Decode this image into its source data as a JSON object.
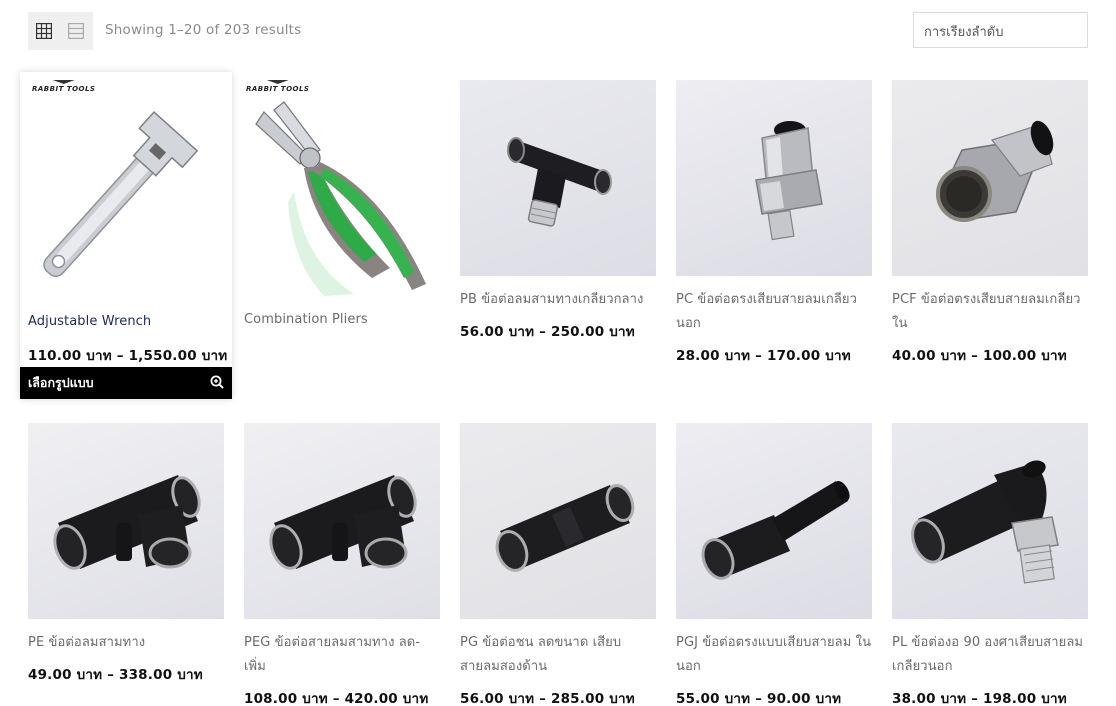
{
  "toolbar": {
    "result_count": "Showing 1–20 of 203 results",
    "sort_placeholder": "การเรียงลำดับ",
    "grid_icon": "grid-view-icon",
    "list_icon": "list-view-icon"
  },
  "products": [
    {
      "title": "Adjustable Wrench",
      "price": "110.00 บาท – 1,550.00 บาท",
      "brand": "RABBIT TOOLS",
      "select_label": "เลือกรูปแบบ",
      "icon": "zoom-in-icon"
    },
    {
      "title": "Combination Pliers",
      "price": "",
      "brand": "RABBIT TOOLS"
    },
    {
      "title": "PB ข้อต่อลมสามทางเกลียวกลาง",
      "price": "56.00 บาท – 250.00 บาท"
    },
    {
      "title": "PC ข้อต่อตรงเสียบสายลมเกลียวนอก",
      "price": "28.00 บาท – 170.00 บาท"
    },
    {
      "title": "PCF ข้อต่อตรงเสียบสายลมเกลียวใน",
      "price": "40.00 บาท – 100.00 บาท"
    },
    {
      "title": "PE ข้อต่อลมสามทาง",
      "price": "49.00 บาท – 338.00 บาท"
    },
    {
      "title": "PEG ข้อต่อสายลมสามทาง ลด-เพิ่ม",
      "price": "108.00 บาท – 420.00 บาท"
    },
    {
      "title": "PG ข้อต่อชน ลดขนาด เสียบสายลมสองด้าน",
      "price": "56.00 บาท – 285.00 บาท"
    },
    {
      "title": "PGJ ข้อต่อตรงแบบเสียบสายลม ในนอก",
      "price": "55.00 บาท – 90.00 บาท"
    },
    {
      "title": "PL ข้อต่องอ 90 องศาเสียบสายลมเกลียวนอก",
      "price": "38.00 บาท – 198.00 บาท"
    }
  ]
}
